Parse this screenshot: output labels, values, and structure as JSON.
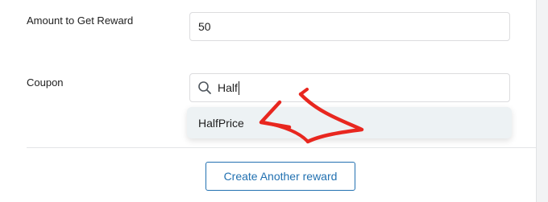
{
  "form": {
    "amount_label": "Amount to Get Reward",
    "amount_value": "50",
    "coupon_label": "Coupon",
    "coupon_search_value": "Half",
    "coupon_option": "HalfPrice"
  },
  "actions": {
    "create_label": "Create Another reward"
  },
  "icons": {
    "search": "search-icon",
    "annotation": "red-arrow-annotation"
  },
  "colors": {
    "accent": "#2271b1",
    "annotation": "#e8271f",
    "dropdown_highlight": "#edf2f4"
  }
}
